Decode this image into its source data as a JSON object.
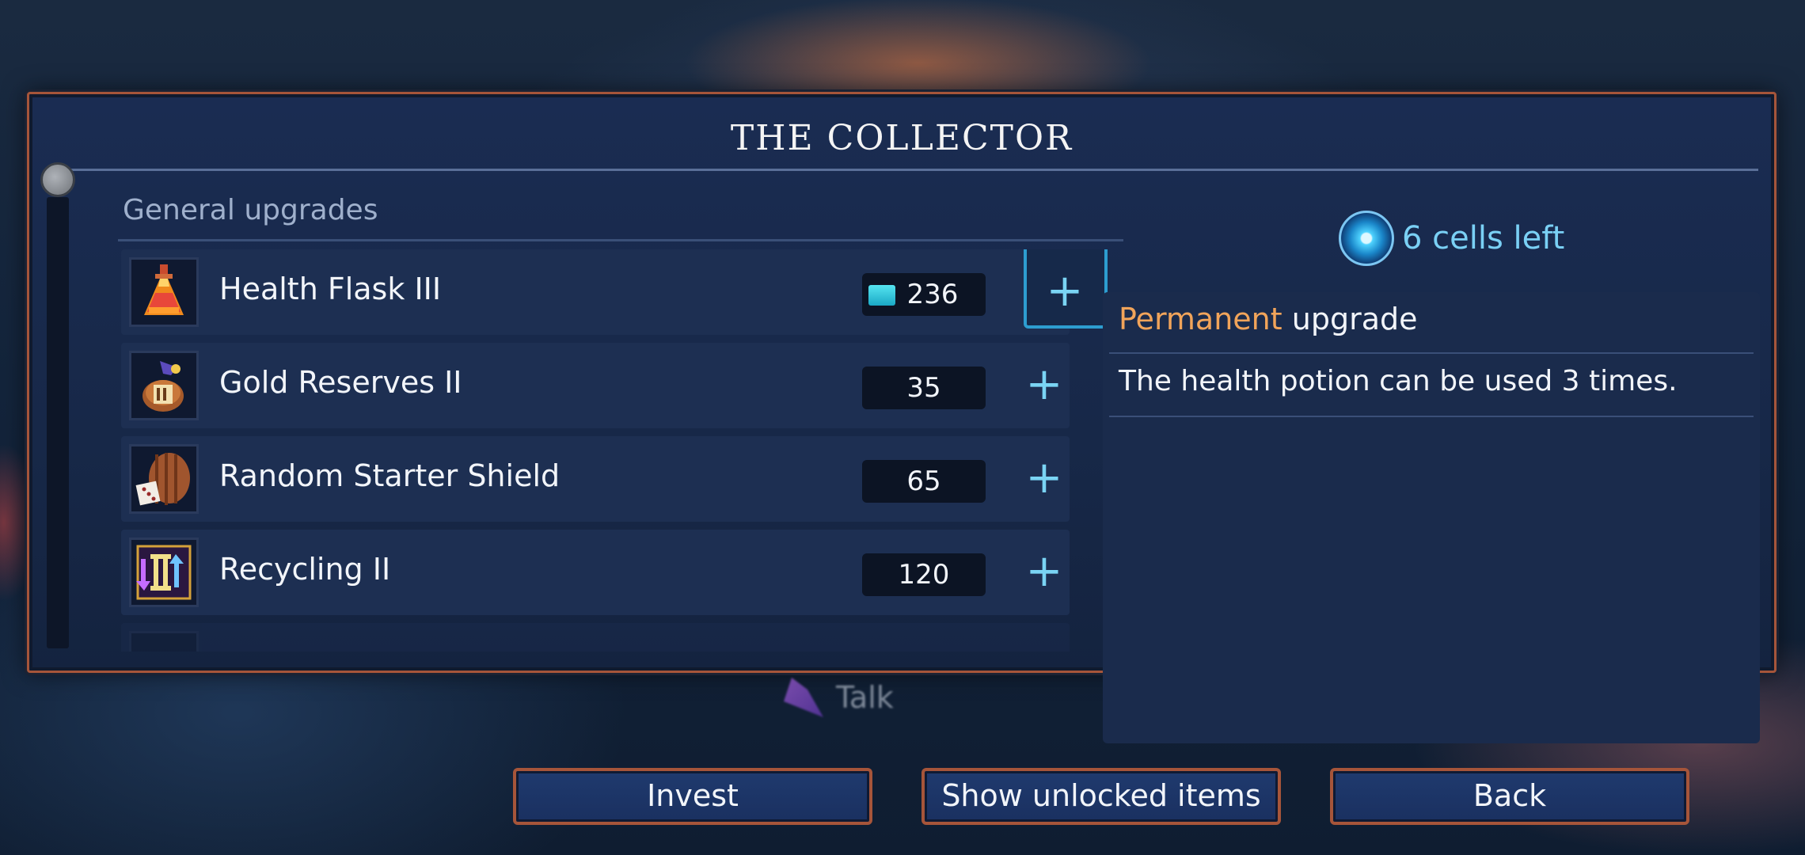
{
  "panel": {
    "title": "THE COLLECTOR",
    "section_label": "General upgrades"
  },
  "items": [
    {
      "name": "Health Flask III",
      "cost": "236",
      "icon": "health-flask-icon",
      "selected": true
    },
    {
      "name": "Gold Reserves II",
      "cost": "35",
      "icon": "gold-reserves-icon"
    },
    {
      "name": "Random Starter Shield",
      "cost": "65",
      "icon": "shield-dice-icon"
    },
    {
      "name": "Recycling II",
      "cost": "120",
      "icon": "recycling-icon"
    }
  ],
  "cells": {
    "count_text": "6 cells left",
    "icon": "cell-icon"
  },
  "detail": {
    "type_accent": "Permanent",
    "type_rest": "upgrade",
    "description": "The health potion can be used 3 times."
  },
  "hint": {
    "text": "Talk",
    "icon": "talk-icon"
  },
  "buttons": {
    "invest": "Invest",
    "show_unlocked": "Show unlocked items",
    "back": "Back"
  },
  "colors": {
    "accent": "#f1a45a",
    "cyan": "#7ad0f5",
    "frame": "#a6553a"
  }
}
